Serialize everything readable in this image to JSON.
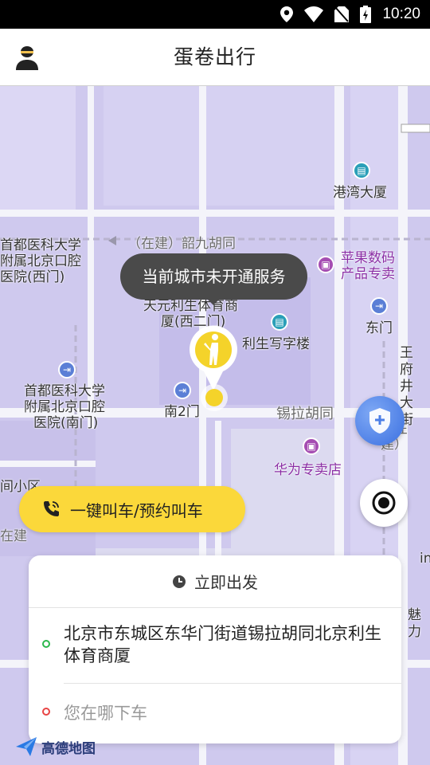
{
  "status_bar": {
    "time": "10:20"
  },
  "header": {
    "title": "蛋卷出行"
  },
  "map": {
    "labels": {
      "gangwan": "港湾大厦",
      "jiujiu": "（在建）韶九胡同",
      "school1_l1": "首都医科大学",
      "school1_l2": "附属北京口腔",
      "school1_l3": "医院(西门)",
      "apple_l1": "苹果数码",
      "apple_l2": "产品专卖",
      "tianyuan_l1": "天元利生体育商",
      "tianyuan_l2": "厦(西二门)",
      "lisheng": "利生写字楼",
      "dongmen": "东门",
      "wangfujing": "王府井大街",
      "school2_l1": "首都医科大学",
      "school2_l2": "附属北京口腔",
      "school2_l3": "医院(南门)",
      "nan2men": "南2门",
      "xila": "锡拉胡同",
      "huawei": "华为专卖店",
      "xiaoqu": "间小区",
      "zaijian_left": "在建",
      "zaijian_right": "（在建）",
      "mo": "魅力",
      "in": "in"
    }
  },
  "tooltip": {
    "text": "当前城市未开通服务"
  },
  "call_button": {
    "label": "一键叫车/预约叫车"
  },
  "trip_card": {
    "depart_label": "立即出发",
    "origin": "北京市东城区东华门街道锡拉胡同北京利生体育商厦",
    "destination_placeholder": "您在哪下车"
  },
  "map_logo": {
    "text": "高德地图"
  },
  "colors": {
    "accent": "#fbd83a",
    "map_bg": "#cfc9ee",
    "origin": "#2db84d",
    "destination": "#e84444"
  }
}
